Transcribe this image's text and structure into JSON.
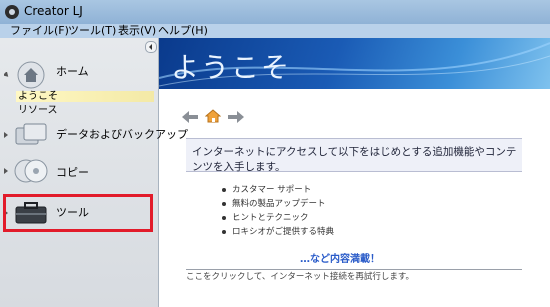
{
  "window": {
    "title": "Creator LJ"
  },
  "menu": [
    {
      "label": "ファイル(F)"
    },
    {
      "label": "ツール(T)"
    },
    {
      "label": "表示(V)"
    },
    {
      "label": "ヘルプ(H)"
    }
  ],
  "sidebar": {
    "home": {
      "label": "ホーム",
      "sub_items": [
        "ようこそ",
        "リソース"
      ]
    },
    "data_backup": {
      "label": "データおよびバックアップ"
    },
    "copy": {
      "label": "コピー"
    },
    "tools": {
      "label": "ツール"
    }
  },
  "main": {
    "banner_title": "ようこそ",
    "info_text": "インターネットにアクセスして以下をはじめとする追加機能やコンテンツを入手します。",
    "list": [
      "カスタマー サポート",
      "無料の製品アップデート",
      "ヒントとテクニック",
      "ロキシオがご提供する特典"
    ],
    "more_link": "…など内容満載！",
    "footer": "ここをクリックして、インターネット接続を再試行します。"
  },
  "colors": {
    "highlight": "#e21b2a",
    "link": "#2b5cc9"
  }
}
